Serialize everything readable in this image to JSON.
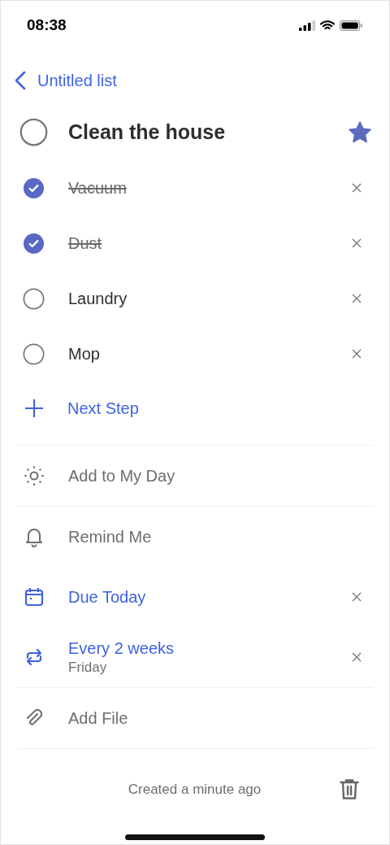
{
  "status_bar": {
    "time": "08:38"
  },
  "navigation": {
    "back_label": "Untitled list"
  },
  "task": {
    "title": "Clean the house",
    "completed": false,
    "important": true
  },
  "steps": [
    {
      "label": "Vacuum",
      "completed": true
    },
    {
      "label": "Dust",
      "completed": true
    },
    {
      "label": "Laundry",
      "completed": false
    },
    {
      "label": "Mop",
      "completed": false
    }
  ],
  "add_step": {
    "label": "Next Step"
  },
  "sections": [
    {
      "options": [
        {
          "kind": "sun",
          "label": "Add to My Day",
          "active": false,
          "clearable": false
        }
      ]
    },
    {
      "options": [
        {
          "kind": "bell",
          "label": "Remind Me",
          "active": false,
          "clearable": false
        },
        {
          "kind": "calendar",
          "label": "Due Today",
          "active": true,
          "clearable": true
        },
        {
          "kind": "repeat",
          "label": "Every 2 weeks",
          "detail": "Friday",
          "active": true,
          "clearable": true
        }
      ]
    },
    {
      "options": [
        {
          "kind": "paperclip",
          "label": "Add File",
          "active": false,
          "clearable": false
        }
      ]
    }
  ],
  "footer": {
    "created": "Created a minute ago"
  }
}
